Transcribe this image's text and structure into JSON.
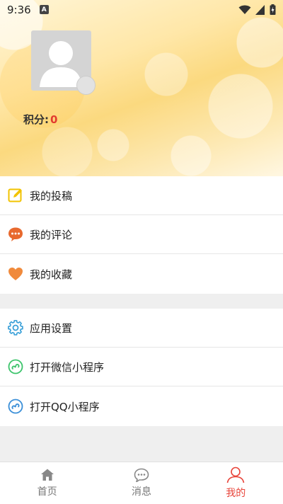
{
  "status_bar": {
    "time": "9:36",
    "notification_badge": "A"
  },
  "profile": {
    "points_label": "积分:",
    "points_value": "0"
  },
  "menu_group_1": [
    {
      "label": "我的投稿",
      "icon": "edit-icon",
      "color": "#f2c300"
    },
    {
      "label": "我的评论",
      "icon": "comment-icon",
      "color": "#e8692e"
    },
    {
      "label": "我的收藏",
      "icon": "heart-icon",
      "color": "#f08a3c"
    }
  ],
  "menu_group_2": [
    {
      "label": "应用设置",
      "icon": "gear-icon",
      "color": "#3aa0d8"
    },
    {
      "label": "打开微信小程序",
      "icon": "wechat-miniprogram-icon",
      "color": "#3cc46b"
    },
    {
      "label": "打开QQ小程序",
      "icon": "qq-miniprogram-icon",
      "color": "#3a8fd8"
    }
  ],
  "tabs": [
    {
      "label": "首页",
      "icon": "home-icon",
      "active": false
    },
    {
      "label": "消息",
      "icon": "message-icon",
      "active": false
    },
    {
      "label": "我的",
      "icon": "user-icon",
      "active": true
    }
  ],
  "colors": {
    "accent": "#e8443a",
    "points_value": "#e23c2f"
  }
}
